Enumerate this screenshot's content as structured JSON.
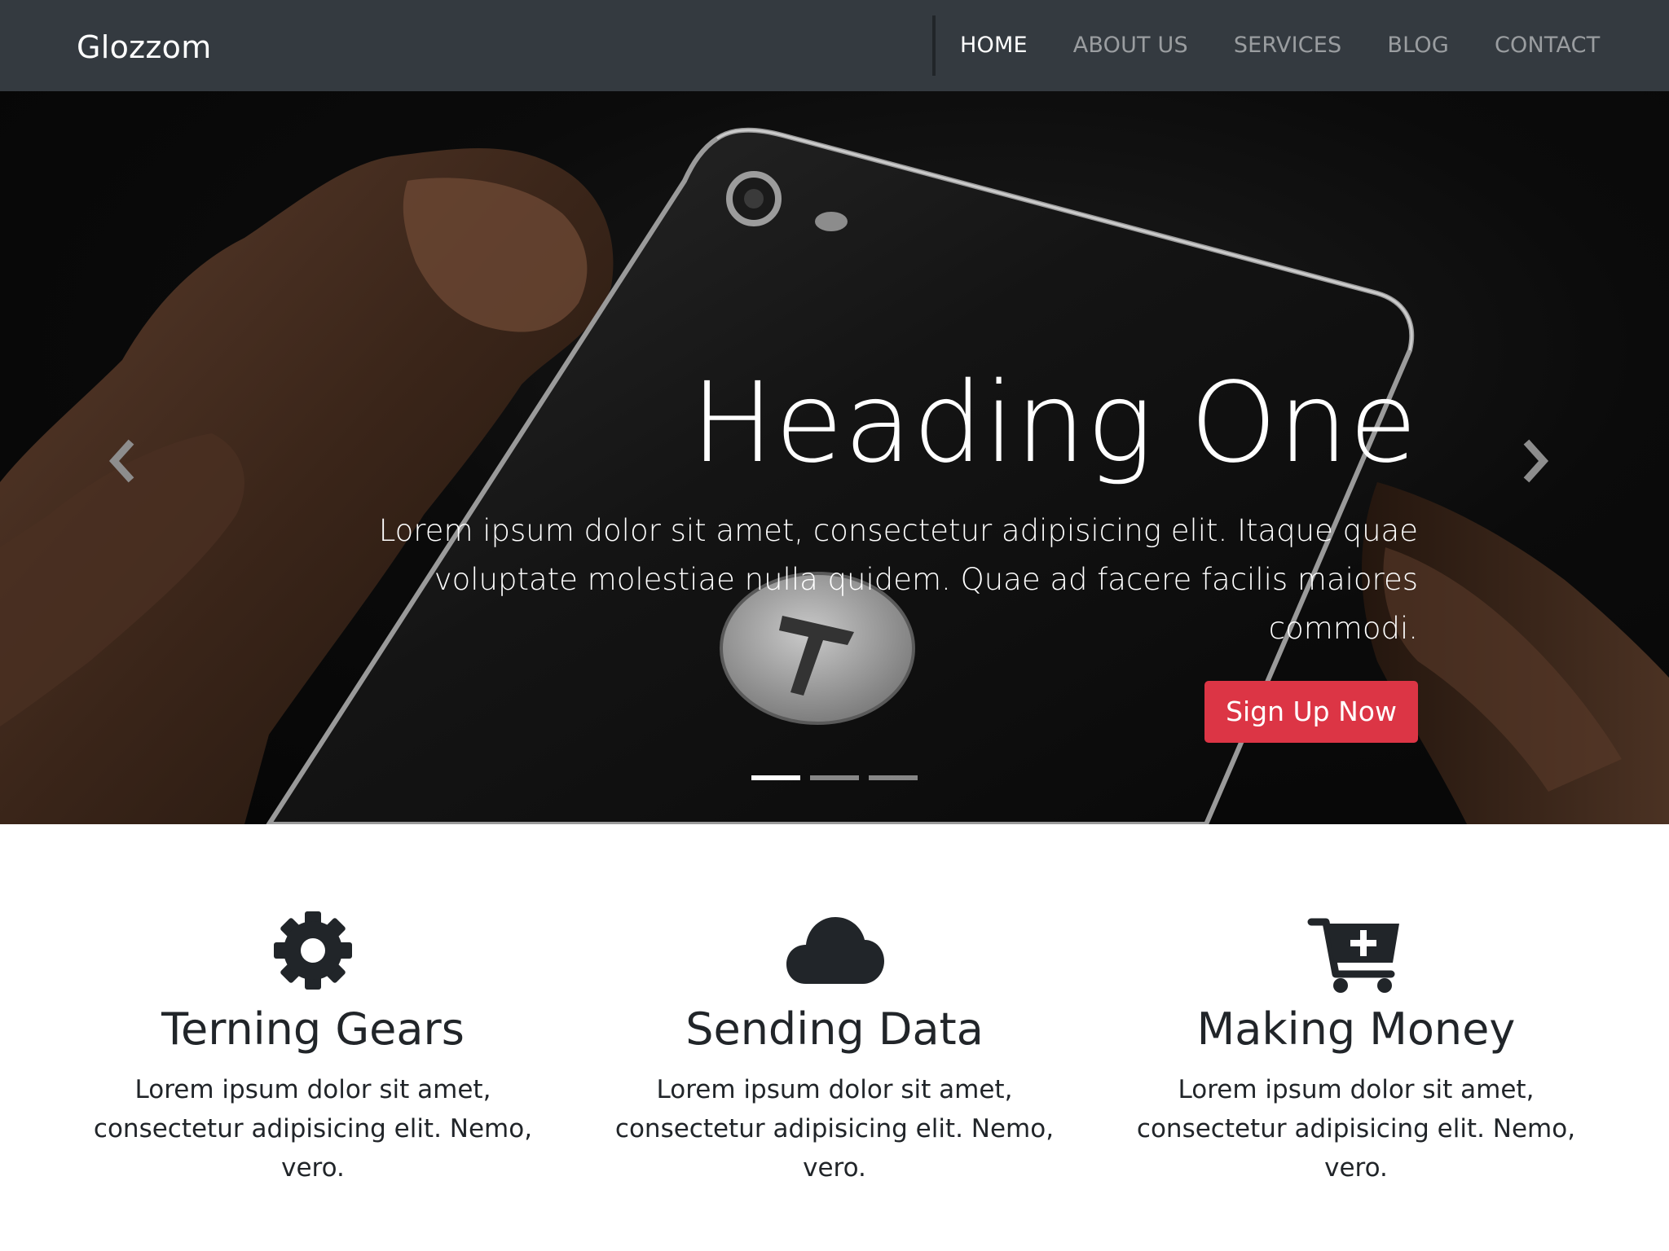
{
  "navbar": {
    "brand": "Glozzom",
    "links": [
      "HOME",
      "ABOUT US",
      "SERVICES",
      "BLOG",
      "CONTACT"
    ],
    "active": "HOME"
  },
  "hero": {
    "title": "Heading One",
    "text": "Lorem ipsum dolor sit amet, consectetur adipisicing elit. Itaque quae voluptate molestiae nulla quidem. Quae ad facere facilis maiores commodi.",
    "button": "Sign Up Now",
    "slide_count": 3,
    "active_slide": 1
  },
  "features": [
    {
      "icon": "gear-icon",
      "title": "Terning Gears",
      "text": "Lorem ipsum dolor sit amet, consectetur adipisicing elit. Nemo, vero."
    },
    {
      "icon": "cloud-icon",
      "title": "Sending Data",
      "text": "Lorem ipsum dolor sit amet, consectetur adipisicing elit. Nemo, vero."
    },
    {
      "icon": "cart-plus-icon",
      "title": "Making Money",
      "text": "Lorem ipsum dolor sit amet, consectetur adipisicing elit. Nemo, vero."
    }
  ],
  "colors": {
    "navbar_bg": "#343a40",
    "accent_button": "#dc3545",
    "text_dark": "#212529"
  }
}
